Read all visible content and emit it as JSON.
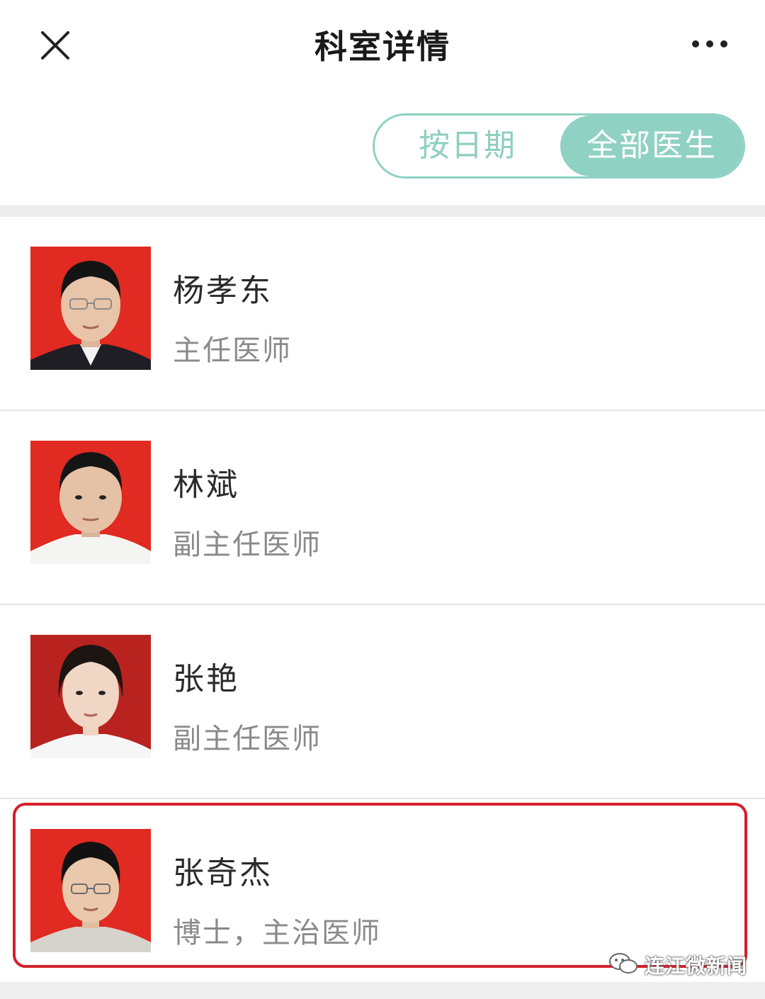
{
  "header": {
    "title": "科室详情"
  },
  "toggle": {
    "by_date_label": "按日期",
    "all_doctors_label": "全部医生",
    "selected": "all_doctors"
  },
  "doctors": [
    {
      "name": "杨孝东",
      "title": "主任医师"
    },
    {
      "name": "林斌",
      "title": "副主任医师"
    },
    {
      "name": "张艳",
      "title": "副主任医师"
    },
    {
      "name": "张奇杰",
      "title": "博士，主治医师"
    }
  ],
  "watermark": {
    "text": "连江微新闻"
  },
  "colors": {
    "accent": "#8fd1c3",
    "highlight_border": "#d4202a",
    "photo_bg": "#e02a22"
  }
}
